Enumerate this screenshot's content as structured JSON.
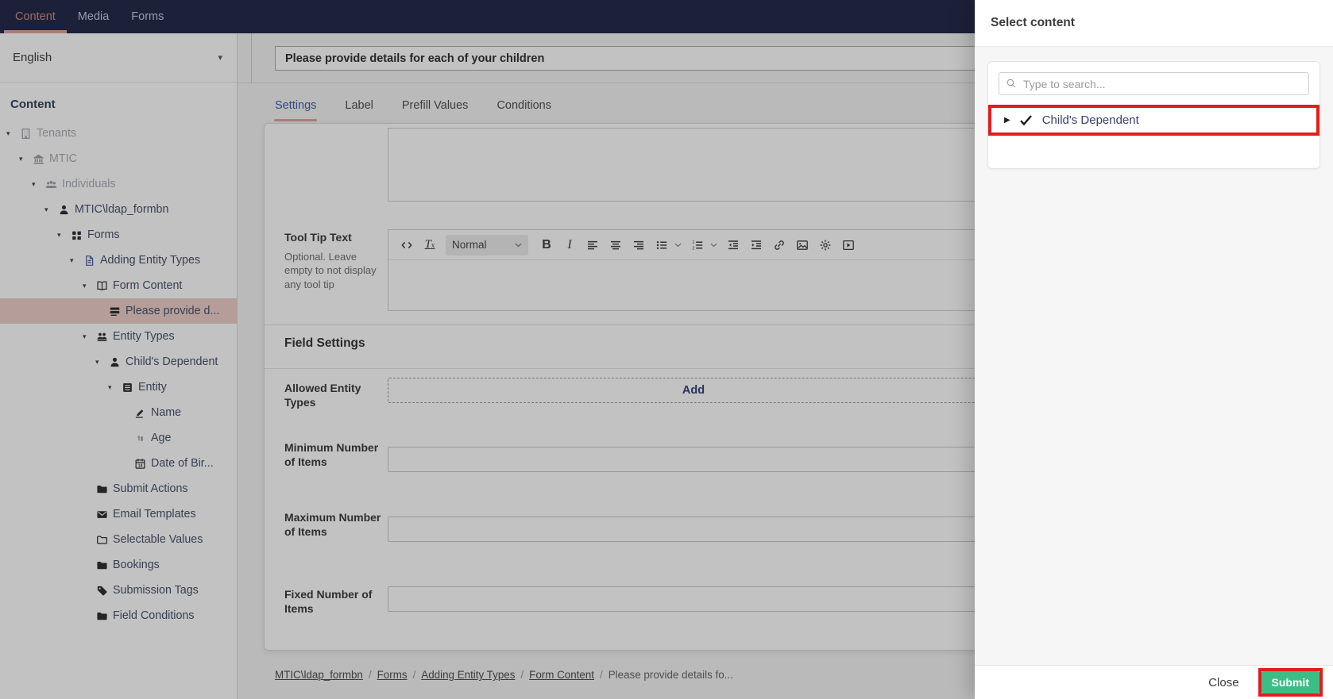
{
  "colors": {
    "navbar_navy": "#222949",
    "accent_salmon": "#cf8b80",
    "accent_salmon_underline": "#dfa49a",
    "active_blue": "#3e5fa8",
    "selected_row_pink": "#eecfc8",
    "submit_green": "#3dbd86",
    "annotation_red": "#e31d1d"
  },
  "topnav": {
    "tabs": [
      {
        "label": "Content",
        "active": true
      },
      {
        "label": "Media",
        "active": false
      },
      {
        "label": "Forms",
        "active": false
      }
    ]
  },
  "sidebar": {
    "language": "English",
    "section_title": "Content",
    "tree": [
      {
        "label": "Tenants",
        "icon": "building",
        "depth": 0,
        "arrow": "down",
        "state": "disabled"
      },
      {
        "label": "MTIC",
        "icon": "bank",
        "depth": 1,
        "arrow": "down",
        "state": "disabled"
      },
      {
        "label": "Individuals",
        "icon": "users",
        "depth": 2,
        "arrow": "down",
        "state": "disabled"
      },
      {
        "label": "MTIC\\ldap_formbn",
        "icon": "user",
        "depth": 3,
        "arrow": "down",
        "state": "normal"
      },
      {
        "label": "Forms",
        "icon": "grid",
        "depth": 4,
        "arrow": "down",
        "state": "normal"
      },
      {
        "label": "Adding Entity Types",
        "icon": "doc",
        "depth": 5,
        "arrow": "down",
        "state": "normal",
        "icon_color": "#4b5aa0"
      },
      {
        "label": "Form Content",
        "icon": "book",
        "depth": 6,
        "arrow": "down",
        "state": "normal"
      },
      {
        "label": "Please provide d...",
        "icon": "formfield",
        "depth": 7,
        "arrow": "none",
        "state": "selected"
      },
      {
        "label": "Entity Types",
        "icon": "people",
        "depth": 6,
        "arrow": "down",
        "state": "normal"
      },
      {
        "label": "Child's Dependent",
        "icon": "user",
        "depth": 7,
        "arrow": "down",
        "state": "normal"
      },
      {
        "label": "Entity",
        "icon": "entity",
        "depth": 8,
        "arrow": "down",
        "state": "normal"
      },
      {
        "label": "Name",
        "icon": "pencil",
        "depth": 9,
        "arrow": "none",
        "state": "normal"
      },
      {
        "label": "Age",
        "icon": "number",
        "depth": 9,
        "arrow": "none",
        "state": "normal",
        "icon_color": "#9aa0a6"
      },
      {
        "label": "Date of Bir...",
        "icon": "calendar",
        "depth": 9,
        "arrow": "none",
        "state": "normal"
      },
      {
        "label": "Submit Actions",
        "icon": "folder",
        "depth": 6,
        "arrow": "none",
        "state": "normal"
      },
      {
        "label": "Email Templates",
        "icon": "envelope",
        "depth": 6,
        "arrow": "none",
        "state": "normal"
      },
      {
        "label": "Selectable Values",
        "icon": "folder-outline",
        "depth": 6,
        "arrow": "none",
        "state": "normal"
      },
      {
        "label": "Bookings",
        "icon": "folder",
        "depth": 6,
        "arrow": "none",
        "state": "normal"
      },
      {
        "label": "Submission Tags",
        "icon": "tag",
        "depth": 6,
        "arrow": "none",
        "state": "normal"
      },
      {
        "label": "Field Conditions",
        "icon": "folder",
        "depth": 6,
        "arrow": "none",
        "state": "normal"
      }
    ]
  },
  "main": {
    "field_title_value": "Please provide details for each of your children",
    "tabs": [
      {
        "label": "Settings",
        "active": true
      },
      {
        "label": "Label",
        "active": false
      },
      {
        "label": "Prefill Values",
        "active": false
      },
      {
        "label": "Conditions",
        "active": false
      }
    ],
    "tooltip": {
      "label": "Tool Tip Text",
      "hint": "Optional. Leave empty to not display any tool tip",
      "editor_paragraph_style": "Normal",
      "toolbar": [
        {
          "kind": "icon",
          "name": "code"
        },
        {
          "kind": "text",
          "name": "clear-format",
          "label": "T"
        },
        {
          "kind": "select",
          "name": "paragraph-style",
          "value": "Normal"
        },
        {
          "kind": "text",
          "name": "bold",
          "label": "B"
        },
        {
          "kind": "text",
          "name": "italic",
          "label": "I"
        },
        {
          "kind": "icon",
          "name": "align-left"
        },
        {
          "kind": "icon",
          "name": "align-center"
        },
        {
          "kind": "icon",
          "name": "align-right"
        },
        {
          "kind": "icon",
          "name": "list-bullet",
          "caret": true
        },
        {
          "kind": "icon",
          "name": "list-ordered",
          "caret": true
        },
        {
          "kind": "icon",
          "name": "outdent"
        },
        {
          "kind": "icon",
          "name": "indent"
        },
        {
          "kind": "icon",
          "name": "link"
        },
        {
          "kind": "icon",
          "name": "image"
        },
        {
          "kind": "icon",
          "name": "gear"
        },
        {
          "kind": "icon",
          "name": "video"
        }
      ]
    },
    "field_settings": {
      "title": "Field Settings",
      "rows": [
        {
          "label": "Allowed Entity Types",
          "control": "add",
          "button_label": "Add"
        },
        {
          "label": "Minimum Number of Items",
          "control": "input",
          "value": ""
        },
        {
          "label": "Maximum Number of Items",
          "control": "input",
          "value": ""
        },
        {
          "label": "Fixed Number of Items",
          "control": "input",
          "value": ""
        }
      ]
    },
    "breadcrumb": {
      "links": [
        "MTIC\\ldap_formbn",
        "Forms",
        "Adding Entity Types",
        "Form Content"
      ],
      "current": "Please provide details fo...",
      "separator": "/"
    }
  },
  "panel": {
    "title": "Select content",
    "search_placeholder": "Type to search...",
    "item": {
      "label": "Child's Dependent",
      "checked": true,
      "collapsed": true
    },
    "close_label": "Close",
    "submit_label": "Submit"
  }
}
